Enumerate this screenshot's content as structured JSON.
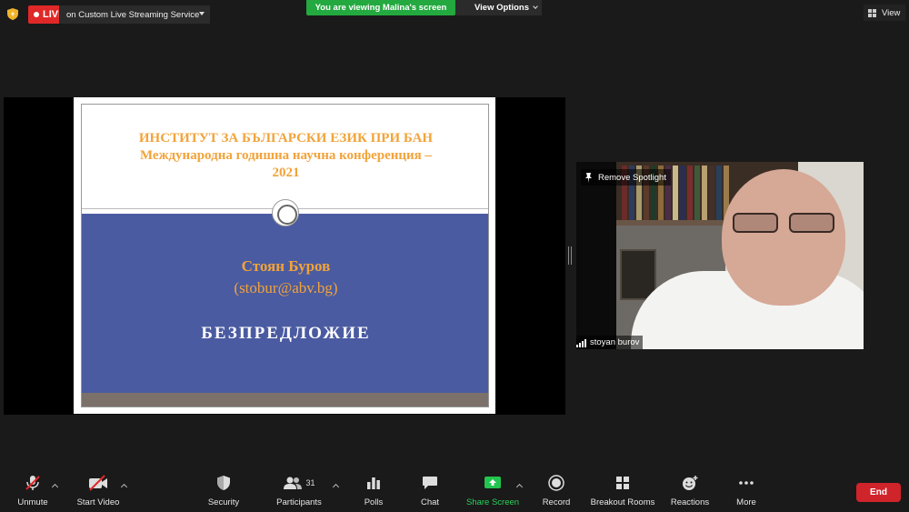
{
  "top_bar": {
    "live_label": "LIVE",
    "stream_service": "on Custom Live Streaming Service",
    "viewing_banner": "You are viewing Malina's screen",
    "view_options": "View Options",
    "view_label": "View"
  },
  "slide": {
    "title_line1": "ИНСТИТУТ ЗА БЪЛГАРСКИ ЕЗИК ПРИ БАН",
    "title_line2": "Международна годишна научна конференция –",
    "title_line3": "2021",
    "author": "Стоян Буров",
    "email": "(stobur@abv.bg)",
    "topic": "БЕЗПРЕДЛОЖИЕ"
  },
  "video": {
    "remove_spotlight": "Remove Spotlight",
    "participant_name": "stoyan burov"
  },
  "toolbar": {
    "unmute": "Unmute",
    "start_video": "Start Video",
    "security": "Security",
    "participants": "Participants",
    "participants_count": "31",
    "polls": "Polls",
    "chat": "Chat",
    "share_screen": "Share Screen",
    "record": "Record",
    "breakout_rooms": "Breakout Rooms",
    "reactions": "Reactions",
    "more": "More",
    "end": "End"
  },
  "colors": {
    "live_red": "#e02828",
    "banner_green": "#23a93f",
    "share_green": "#2bd15c",
    "end_red": "#d0242b",
    "slide_orange": "#f2a33a",
    "slide_blue": "#4a5ba1"
  }
}
